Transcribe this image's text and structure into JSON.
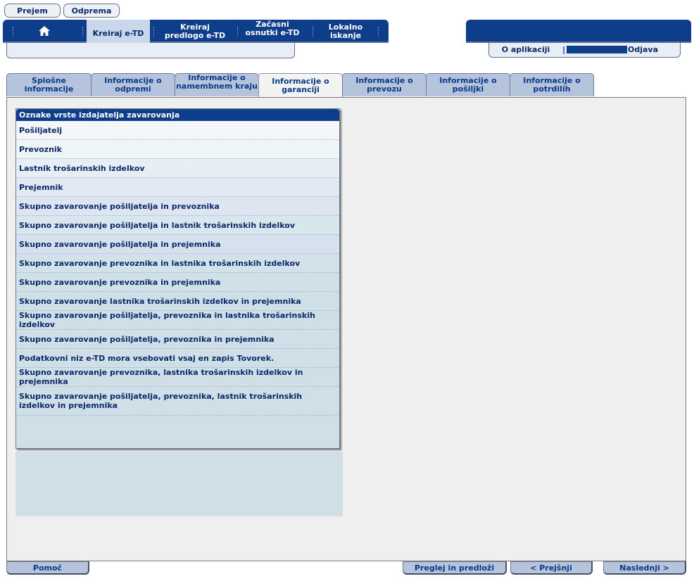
{
  "top_buttons": {
    "receive": "Prejem",
    "dispatch": "Odprema"
  },
  "nav": {
    "home_icon": "home-icon",
    "items": [
      {
        "label": "Kreiraj e-TD",
        "active": true
      },
      {
        "label": "Kreiraj predlogo e-TD",
        "active": false
      },
      {
        "label": "Začasni osnutki e-TD",
        "active": false
      },
      {
        "label": "Lokalno iskanje",
        "active": false
      }
    ]
  },
  "user_bar": {
    "about": "O aplikaciji",
    "logout": "Odjava",
    "separator": "|"
  },
  "tabs": [
    {
      "label": "Splošne informacije",
      "active": false
    },
    {
      "label": "Informacije o odpremi",
      "active": false
    },
    {
      "label": "Informacije o namembnem kraju",
      "active": false
    },
    {
      "label": "Informacije o garanciji",
      "active": true
    },
    {
      "label": "Informacije o prevozu",
      "active": false
    },
    {
      "label": "Informacije o pošiljki",
      "active": false
    },
    {
      "label": "Informacije o potrdilih",
      "active": false
    }
  ],
  "guarantor_list": {
    "title": "Oznake vrste izdajatelja zavarovanja",
    "items": [
      "Pošiljatelj",
      "Prevoznik",
      "Lastnik trošarinskih izdelkov",
      "Prejemnik",
      "Skupno zavarovanje pošiljatelja in prevoznika",
      "Skupno zavarovanje pošiljatelja in lastnik trošarinskih izdelkov",
      "Skupno zavarovanje pošiljatelja in prejemnika",
      "Skupno zavarovanje prevoznika in lastnika trošarinskih izdelkov",
      "Skupno zavarovanje prevoznika in prejemnika",
      "Skupno zavarovanje lastnika trošarinskih izdelkov in prejemnika",
      "Skupno zavarovanje pošiljatelja, prevoznika in lastnika trošarinskih izdelkov",
      "Skupno zavarovanje pošiljatelja, prevoznika in prejemnika",
      "Podatkovni niz e-TD mora vsebovati vsaj en zapis Tovorek.",
      "Skupno zavarovanje prevoznika, lastnika trošarinskih izdelkov in prejemnika",
      "Skupno zavarovanje pošiljatelja, prevoznika, lastnik trošarinskih izdelkov in prejemnika"
    ]
  },
  "footer": {
    "help": "Pomoč",
    "review_submit": "Preglej in predloži",
    "previous": "< Prejšnji",
    "next": "Naslednji >"
  },
  "colors": {
    "primary": "#0e3d8a",
    "tab": "#b5c3dc",
    "panel": "#cfdee7",
    "content": "#efefef"
  }
}
